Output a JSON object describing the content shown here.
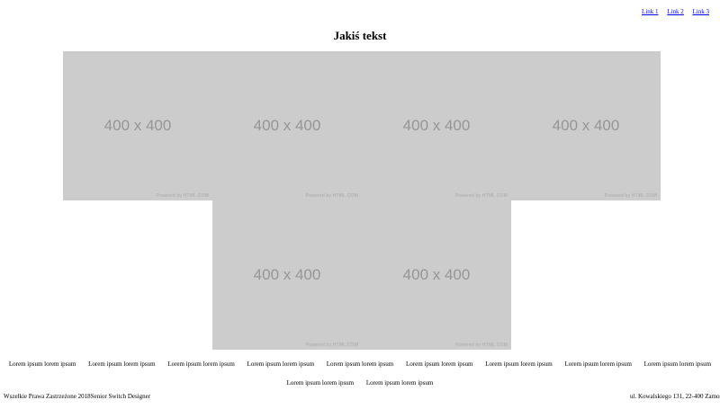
{
  "nav": {
    "links": [
      "Link 1",
      "Link 2",
      "Link 3"
    ]
  },
  "title": "Jakiś tekst",
  "gallery": {
    "tile_label": "400 x 400",
    "tile_credit": "Powered by HTML.COM"
  },
  "items": [
    "Lorem ipsum lorem ipsum",
    "Lorem ipsum lorem ipsum",
    "Lorem ipsum lorem ipsum",
    "Lorem ipsum lorem ipsum",
    "Lorem ipsum lorem ipsum",
    "Lorem ipsum lorem ipsum",
    "Lorem ipsum lorem ipsum",
    "Lorem ipsum lorem ipsum",
    "Lorem ipsum lorem ipsum",
    "Lorem ipsum lorem ipsum",
    "Lorem ipsum lorem ipsum"
  ],
  "footer": {
    "left": "Wszelkie Prawa Zastrzeżone 2018Senior Switch Designer",
    "right": "ul. Kowalskiego 131, 22-400 Zamość"
  }
}
